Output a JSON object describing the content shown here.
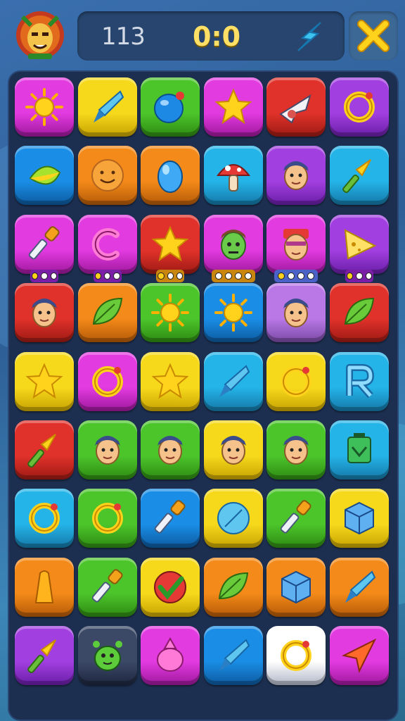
{
  "header": {
    "moves_label": "113",
    "score_label": "0:0",
    "avatar_icon": "lion-mask-icon",
    "boost_icon": "lightning-icon",
    "close_icon": "close-icon"
  },
  "colors": {
    "purple": "#a23fe0",
    "magenta": "#e23be0",
    "yellow": "#f7d91c",
    "green": "#4cc52b",
    "red": "#e0322a",
    "orange": "#f48a19",
    "blue": "#1a8ee6",
    "cyan": "#25b4e8",
    "lilac": "#b978e6",
    "slate": "#3b4866",
    "white": "#ffffff"
  },
  "board": {
    "rows": [
      [
        {
          "color": "magenta",
          "icon": "sun-icon"
        },
        {
          "color": "yellow",
          "icon": "gem-icon"
        },
        {
          "color": "green",
          "icon": "ball-icon"
        },
        {
          "color": "magenta",
          "icon": "star-icon"
        },
        {
          "color": "red",
          "icon": "plane-icon"
        },
        {
          "color": "purple",
          "icon": "ring-icon"
        }
      ],
      [
        {
          "color": "blue",
          "icon": "leaf-drop-icon"
        },
        {
          "color": "orange",
          "icon": "smiley-icon"
        },
        {
          "color": "orange",
          "icon": "egg-icon"
        },
        {
          "color": "cyan",
          "icon": "mushroom-icon"
        },
        {
          "color": "purple",
          "icon": "face-icon"
        },
        {
          "color": "cyan",
          "icon": "torch-icon"
        }
      ],
      [
        {
          "color": "magenta",
          "icon": "dropper-icon"
        },
        {
          "color": "magenta",
          "icon": "letter-c-icon"
        },
        {
          "color": "red",
          "icon": "star-icon"
        },
        {
          "color": "magenta",
          "icon": "zombie-face-icon"
        },
        {
          "color": "magenta",
          "icon": "robot-face-icon"
        },
        {
          "color": "purple",
          "icon": "cheese-icon"
        }
      ],
      [
        {
          "color": "red",
          "icon": "face-icon"
        },
        {
          "color": "orange",
          "icon": "leaf-icon"
        },
        {
          "color": "green",
          "icon": "sun-icon"
        },
        {
          "color": "blue",
          "icon": "sun-icon"
        },
        {
          "color": "lilac",
          "icon": "face-icon"
        },
        {
          "color": "red",
          "icon": "leaf-icon"
        }
      ],
      [
        {
          "color": "yellow",
          "icon": "star-icon"
        },
        {
          "color": "magenta",
          "icon": "ring-icon"
        },
        {
          "color": "yellow",
          "icon": "star-icon"
        },
        {
          "color": "cyan",
          "icon": "gem-icon"
        },
        {
          "color": "yellow",
          "icon": "ring-icon"
        },
        {
          "color": "cyan",
          "icon": "letter-r-icon"
        }
      ],
      [
        {
          "color": "red",
          "icon": "torch-icon"
        },
        {
          "color": "green",
          "icon": "face-icon"
        },
        {
          "color": "green",
          "icon": "face-icon"
        },
        {
          "color": "yellow",
          "icon": "face-icon"
        },
        {
          "color": "green",
          "icon": "face-icon"
        },
        {
          "color": "cyan",
          "icon": "box-icon"
        }
      ],
      [
        {
          "color": "cyan",
          "icon": "ring-icon"
        },
        {
          "color": "green",
          "icon": "ring-icon"
        },
        {
          "color": "blue",
          "icon": "dropper-icon"
        },
        {
          "color": "yellow",
          "icon": "compass-icon"
        },
        {
          "color": "green",
          "icon": "dropper-icon"
        },
        {
          "color": "yellow",
          "icon": "cube-icon"
        }
      ],
      [
        {
          "color": "orange",
          "icon": "cone-icon"
        },
        {
          "color": "green",
          "icon": "dropper-icon"
        },
        {
          "color": "yellow",
          "icon": "check-icon"
        },
        {
          "color": "orange",
          "icon": "leaf-icon"
        },
        {
          "color": "orange",
          "icon": "cube-icon"
        },
        {
          "color": "orange",
          "icon": "gem-icon"
        }
      ],
      [
        {
          "color": "purple",
          "icon": "torch-icon"
        },
        {
          "color": "slate",
          "icon": "monster-icon"
        },
        {
          "color": "magenta",
          "icon": "potion-icon"
        },
        {
          "color": "blue",
          "icon": "gem-icon"
        },
        {
          "color": "white",
          "icon": "ring-icon"
        },
        {
          "color": "magenta",
          "icon": "arrow-icon"
        }
      ]
    ],
    "progress_badges": [
      {
        "col": 0,
        "filled": 1,
        "total": 3,
        "color": "#7a1ea8"
      },
      {
        "col": 1,
        "filled": 1,
        "total": 3,
        "color": "#7a1ea8"
      },
      {
        "col": 2,
        "filled": 1,
        "total": 3,
        "color": "#c9860e"
      },
      {
        "col": 3,
        "filled": 0,
        "total": 4,
        "color": "#c9860e"
      },
      {
        "col": 4,
        "filled": 1,
        "total": 4,
        "color": "#4a62c8"
      },
      {
        "col": 5,
        "filled": 1,
        "total": 3,
        "color": "#7a1ea8"
      }
    ]
  }
}
